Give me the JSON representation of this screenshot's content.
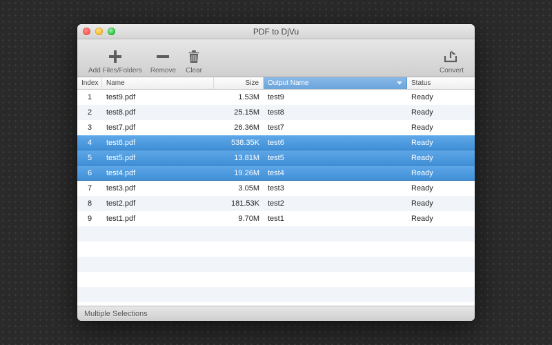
{
  "window": {
    "title": "PDF to DjVu"
  },
  "toolbar": {
    "add_label": "Add Files/Folders",
    "remove_label": "Remove",
    "clear_label": "Clear",
    "convert_label": "Convert"
  },
  "columns": {
    "index": "Index",
    "name": "Name",
    "size": "Size",
    "output": "Output Name",
    "status": "Status"
  },
  "rows": [
    {
      "index": "1",
      "name": "test9.pdf",
      "size": "1.53M",
      "output": "test9",
      "status": "Ready",
      "selected": false
    },
    {
      "index": "2",
      "name": "test8.pdf",
      "size": "25.15M",
      "output": "test8",
      "status": "Ready",
      "selected": false
    },
    {
      "index": "3",
      "name": "test7.pdf",
      "size": "26.36M",
      "output": "test7",
      "status": "Ready",
      "selected": false
    },
    {
      "index": "4",
      "name": "test6.pdf",
      "size": "538.35K",
      "output": "test6",
      "status": "Ready",
      "selected": true
    },
    {
      "index": "5",
      "name": "test5.pdf",
      "size": "13.81M",
      "output": "test5",
      "status": "Ready",
      "selected": true
    },
    {
      "index": "6",
      "name": "test4.pdf",
      "size": "19.26M",
      "output": "test4",
      "status": "Ready",
      "selected": true
    },
    {
      "index": "7",
      "name": "test3.pdf",
      "size": "3.05M",
      "output": "test3",
      "status": "Ready",
      "selected": false
    },
    {
      "index": "8",
      "name": "test2.pdf",
      "size": "181.53K",
      "output": "test2",
      "status": "Ready",
      "selected": false
    },
    {
      "index": "9",
      "name": "test1.pdf",
      "size": "9.70M",
      "output": "test1",
      "status": "Ready",
      "selected": false
    }
  ],
  "statusbar": {
    "text": "Multiple Selections"
  }
}
